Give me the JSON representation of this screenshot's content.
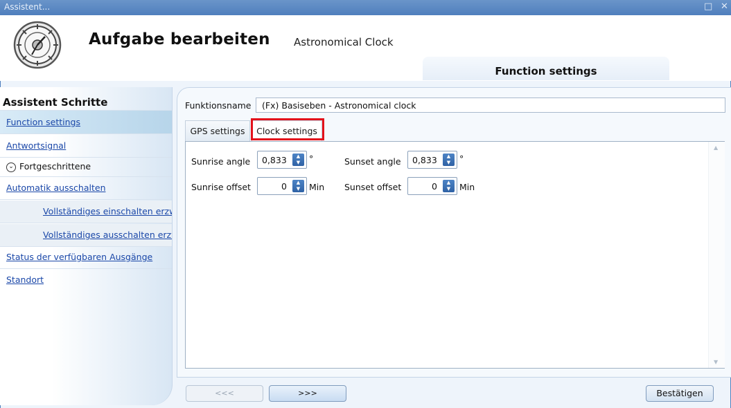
{
  "window": {
    "title": "Assistent..."
  },
  "header": {
    "title": "Aufgabe bearbeiten",
    "subtitle": "Astronomical Clock",
    "section_tab": "Function settings"
  },
  "sidebar": {
    "heading": "Assistent Schritte",
    "items": [
      {
        "label": "Function settings",
        "active": true
      },
      {
        "label": "Antwortsignal"
      },
      {
        "label": "Automatik ausschalten"
      },
      {
        "label": "Vollständiges einschalten erzw"
      },
      {
        "label": "Vollständiges ausschalten erzw"
      },
      {
        "label": "Status der verfügbaren Ausgänge"
      },
      {
        "label": "Standort"
      }
    ],
    "expander": {
      "label": "Fortgeschrittene",
      "icon": "chevron-down-circle-icon"
    }
  },
  "form": {
    "function_name_label": "Funktionsname",
    "function_name_value": "(Fx) Basiseben - Astronomical clock",
    "tabs": [
      {
        "label": "GPS settings"
      },
      {
        "label": "Clock settings",
        "active": true,
        "highlighted": true
      }
    ],
    "fields": {
      "sunrise_angle": {
        "label": "Sunrise angle",
        "value": "0,833",
        "unit": "°"
      },
      "sunset_angle": {
        "label": "Sunset angle",
        "value": "0,833",
        "unit": "°"
      },
      "sunrise_offset": {
        "label": "Sunrise offset",
        "value": "0",
        "unit": "Min"
      },
      "sunset_offset": {
        "label": "Sunset offset",
        "value": "0",
        "unit": "Min"
      }
    }
  },
  "footer": {
    "back_label": "<<<",
    "next_label": ">>>",
    "confirm_label": "Bestätigen"
  },
  "colors": {
    "titlebar": "#5b89c4",
    "highlight_border": "#e3121b",
    "link": "#1a47a8",
    "spinner": "#2f62a5"
  }
}
